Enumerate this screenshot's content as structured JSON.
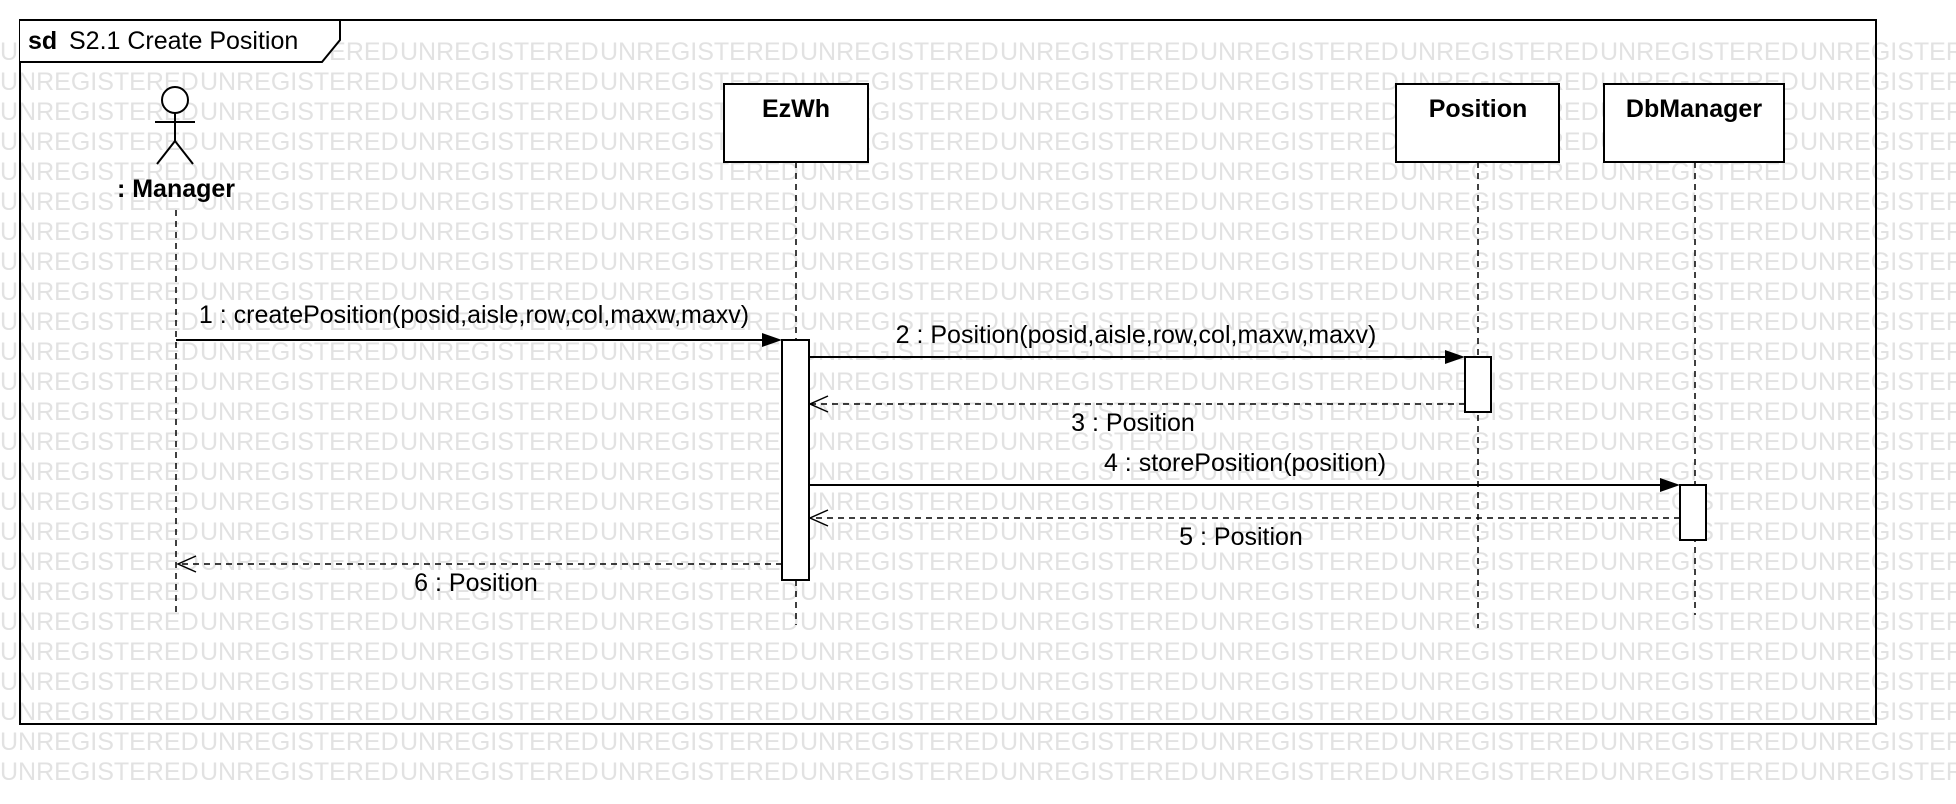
{
  "frame": {
    "keyword": "sd",
    "title": "S2.1 Create Position"
  },
  "watermark": {
    "text": "UNREGISTERED"
  },
  "actor": {
    "name": ": Manager"
  },
  "lifelines": [
    {
      "name": "EzWh"
    },
    {
      "name": "Position"
    },
    {
      "name": "DbManager"
    }
  ],
  "messages": [
    {
      "label": "1 : createPosition(posid,aisle,row,col,maxw,maxv)",
      "kind": "sync"
    },
    {
      "label": "2 : Position(posid,aisle,row,col,maxw,maxv)",
      "kind": "sync"
    },
    {
      "label": "3 : Position",
      "kind": "return"
    },
    {
      "label": "4 : storePosition(position)",
      "kind": "sync"
    },
    {
      "label": "5 : Position",
      "kind": "return"
    },
    {
      "label": "6 : Position",
      "kind": "return"
    }
  ],
  "colors": {
    "stroke": "#000000",
    "background": "#ffffff",
    "watermark": "#e2e2e2"
  }
}
